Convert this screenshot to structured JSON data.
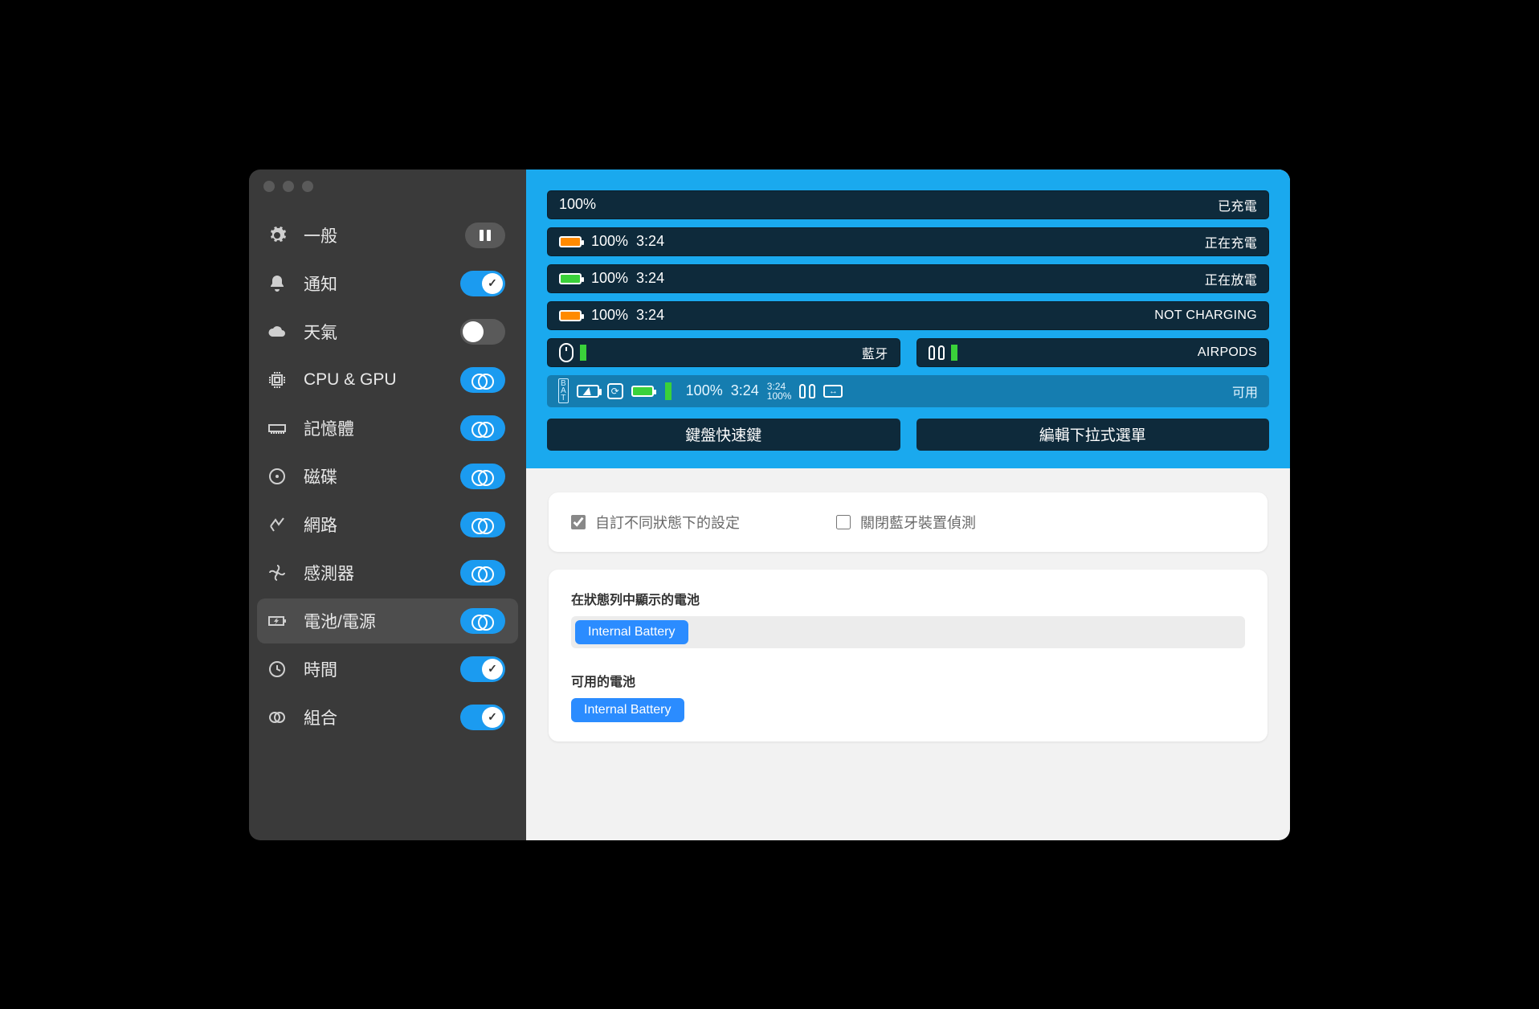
{
  "sidebar": {
    "items": [
      {
        "label": "一般",
        "icon": "gear",
        "control": "pause",
        "selected": false
      },
      {
        "label": "通知",
        "icon": "bell",
        "control": "toggle-on",
        "selected": false
      },
      {
        "label": "天氣",
        "icon": "cloud",
        "control": "toggle-off",
        "selected": false
      },
      {
        "label": "CPU & GPU",
        "icon": "chip",
        "control": "link",
        "selected": false
      },
      {
        "label": "記憶體",
        "icon": "ram",
        "control": "link",
        "selected": false
      },
      {
        "label": "磁碟",
        "icon": "disk",
        "control": "link",
        "selected": false
      },
      {
        "label": "網路",
        "icon": "net",
        "control": "link",
        "selected": false
      },
      {
        "label": "感測器",
        "icon": "fan",
        "control": "link",
        "selected": false
      },
      {
        "label": "電池/電源",
        "icon": "battery",
        "control": "link",
        "selected": true
      },
      {
        "label": "時間",
        "icon": "clock",
        "control": "toggle-on",
        "selected": false
      },
      {
        "label": "組合",
        "icon": "rings",
        "control": "toggle-on",
        "selected": false
      }
    ]
  },
  "preview": {
    "rows": [
      {
        "pct": "100%",
        "status": "已充電"
      },
      {
        "pct": "100%",
        "time": "3:24",
        "status": "正在充電",
        "battColor": "orange"
      },
      {
        "pct": "100%",
        "time": "3:24",
        "status": "正在放電",
        "battColor": "green"
      },
      {
        "pct": "100%",
        "time": "3:24",
        "status": "NOT CHARGING",
        "battColor": "orange"
      }
    ],
    "half": [
      {
        "status": "藍牙"
      },
      {
        "status": "AIRPODS"
      }
    ],
    "available": {
      "pct": "100%",
      "time": "3:24",
      "stack_top": "3:24",
      "stack_bot": "100%",
      "label": "可用"
    },
    "buttons": {
      "left": "鍵盤快速鍵",
      "right": "編輯下拉式選單"
    }
  },
  "settings": {
    "custom_states_checked": true,
    "custom_states_label": "自訂不同狀態下的設定",
    "bt_disable_checked": false,
    "bt_disable_label": "關閉藍牙裝置偵測",
    "shown_header": "在狀態列中顯示的電池",
    "shown_tag": "Internal Battery",
    "avail_header": "可用的電池",
    "avail_tag": "Internal Battery"
  },
  "colors": {
    "accent": "#1aa9ee",
    "darkbar": "#0e2a3b",
    "tag": "#2b8cff"
  }
}
